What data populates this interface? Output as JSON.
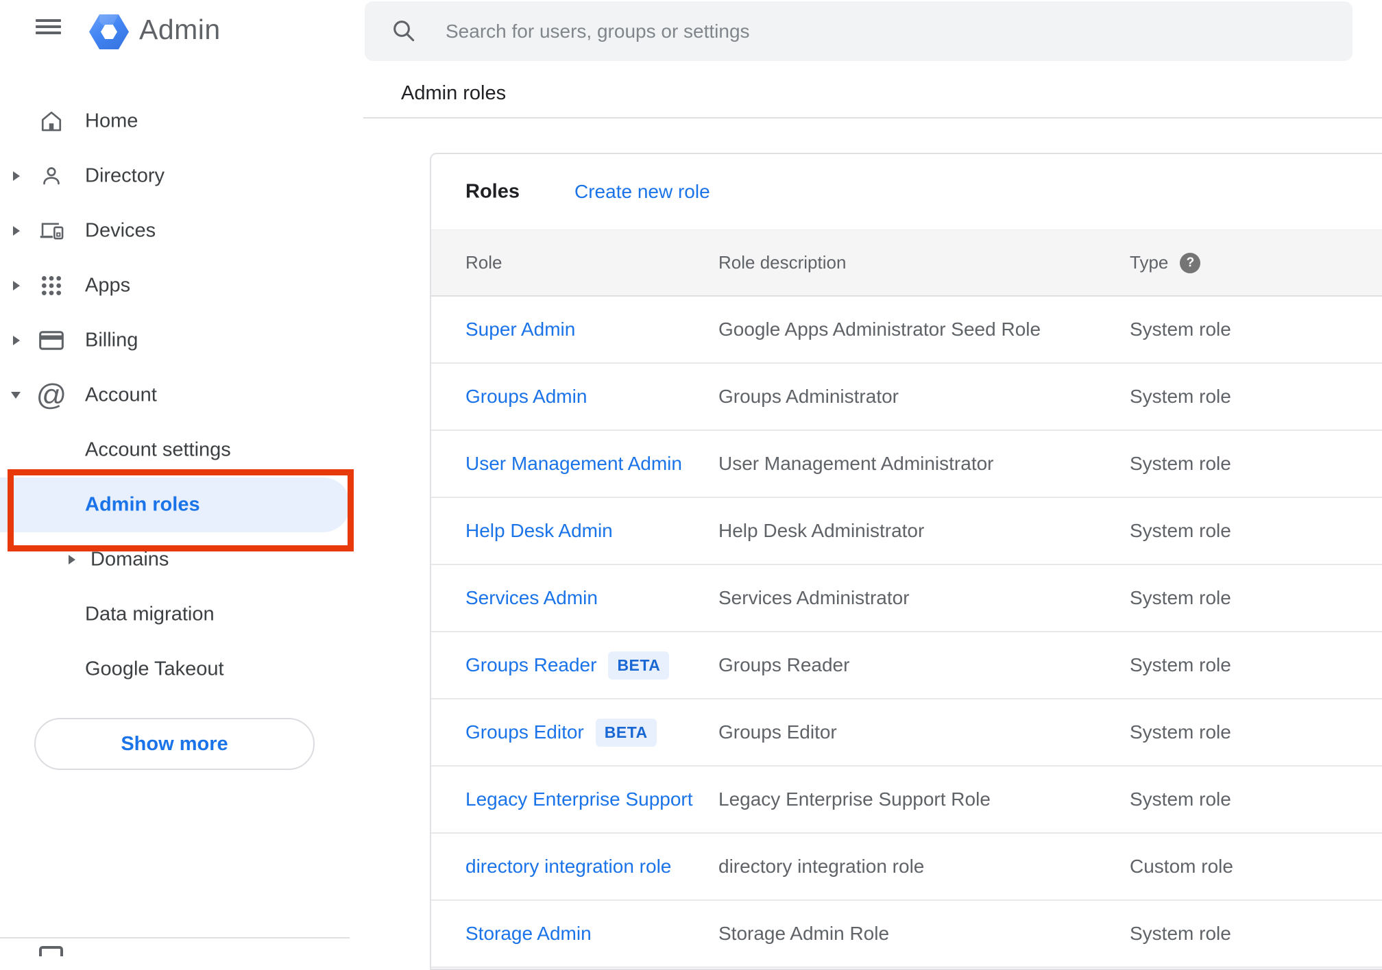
{
  "sidebar": {
    "app_title": "Admin",
    "nav": [
      {
        "label": "Home",
        "icon": "home-icon"
      },
      {
        "label": "Directory",
        "icon": "person-icon"
      },
      {
        "label": "Devices",
        "icon": "devices-icon"
      },
      {
        "label": "Apps",
        "icon": "apps-grid-icon"
      },
      {
        "label": "Billing",
        "icon": "credit-card-icon"
      },
      {
        "label": "Account",
        "icon": "at-icon",
        "icon_glyph": "@"
      }
    ],
    "account_children": [
      {
        "label": "Account settings"
      },
      {
        "label": "Admin roles",
        "selected": true
      },
      {
        "label": "Domains"
      },
      {
        "label": "Data migration"
      },
      {
        "label": "Google Takeout"
      }
    ],
    "show_more_label": "Show more"
  },
  "search": {
    "placeholder": "Search for users, groups or settings"
  },
  "breadcrumb": "Admin roles",
  "roles_card": {
    "title": "Roles",
    "create_link": "Create new role",
    "columns": [
      "Role",
      "Role description",
      "Type"
    ],
    "help_icon_glyph": "?",
    "beta_label": "BETA",
    "rows": [
      {
        "role": "Super Admin",
        "beta": false,
        "description": "Google Apps Administrator Seed Role",
        "type": "System role"
      },
      {
        "role": "Groups Admin",
        "beta": false,
        "description": "Groups Administrator",
        "type": "System role"
      },
      {
        "role": "User Management Admin",
        "beta": false,
        "description": "User Management Administrator",
        "type": "System role"
      },
      {
        "role": "Help Desk Admin",
        "beta": false,
        "description": "Help Desk Administrator",
        "type": "System role"
      },
      {
        "role": "Services Admin",
        "beta": false,
        "description": "Services Administrator",
        "type": "System role"
      },
      {
        "role": "Groups Reader",
        "beta": true,
        "description": "Groups Reader",
        "type": "System role"
      },
      {
        "role": "Groups Editor",
        "beta": true,
        "description": "Groups Editor",
        "type": "System role"
      },
      {
        "role": "Legacy Enterprise Support",
        "beta": false,
        "description": "Legacy Enterprise Support Role",
        "type": "System role"
      },
      {
        "role": "directory integration role",
        "beta": false,
        "description": "directory integration role",
        "type": "Custom role"
      },
      {
        "role": "Storage Admin",
        "beta": false,
        "description": "Storage Admin Role",
        "type": "System role"
      }
    ]
  },
  "colors": {
    "link_blue": "#1a73e8",
    "selected_item_bg": "#e8f0fe",
    "annotation_red": "#e8390d",
    "beta_text": "#1967d2",
    "beta_bg": "#e8f0fe",
    "icon_gray": "#5f6368",
    "text_dark": "#202124",
    "text_gray": "#5f6368",
    "placeholder_gray": "#80868b",
    "search_bg": "#f1f3f4",
    "table_header_bg": "#f5f5f5",
    "divider": "#e0e0e0"
  }
}
